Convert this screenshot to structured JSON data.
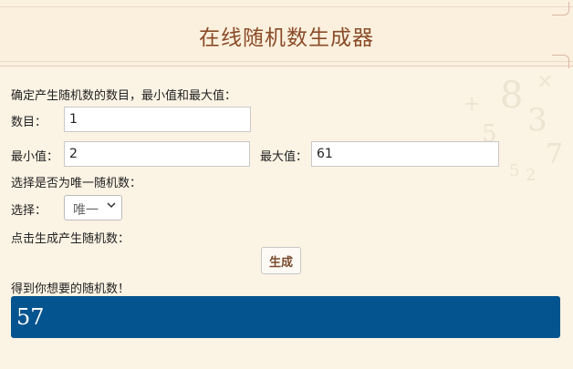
{
  "header": {
    "title": "在线随机数生成器"
  },
  "form": {
    "intro": "确定产生随机数的数目，最小值和最大值：",
    "count_label": "数目：",
    "count_value": "1",
    "min_label": "最小值：",
    "min_value": "2",
    "max_label": "最大值：",
    "max_value": "61",
    "unique_prompt": "选择是否为唯一随机数：",
    "choice_label": "选择：",
    "choice_value": "唯一",
    "generate_prompt": "点击生成产生随机数：",
    "generate_button": "生成",
    "result_label": "得到你想要的随机数！",
    "result_value": "57"
  },
  "colors": {
    "background": "#fbf3e4",
    "title": "#8a4b28",
    "result_bg": "#04548f",
    "result_text": "#ffffff"
  },
  "icons": {
    "select_arrow": "chevron-down-icon"
  }
}
